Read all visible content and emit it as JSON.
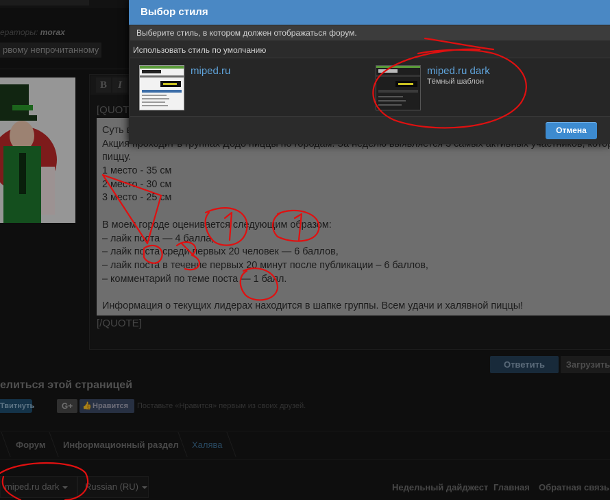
{
  "forum": {
    "moderators_label": "ераторы:",
    "moderator_name": "morax",
    "unread_button": "рвому непрочитанному",
    "editor_bold": "B",
    "editor_italic": "I",
    "quote_open": "[QUOTE",
    "quote_close": "[/QUOTE]",
    "quote_lines": [
      "Суть в",
      "Акция проходит в группах Додо пиццы по городам. За неделю выявляется 3 самых активных участников, которые получают",
      "пиццу.",
      "1 место - 35 см",
      "2 место - 30 см",
      "3 место - 25 см",
      "",
      "В моем городе оценивается следующим образом:",
      "– лайк поста — 4 балла,",
      "– лайк поста среди первых 20 человек — 6 баллов,",
      "– лайк поста в течение первых 20 минут после публикации – 6 баллов,",
      "– комментарий по теме поста — 1 балл.",
      "",
      "Информация о текущих лидерах находится в шапке группы. Всем удачи и халявной пиццы!"
    ],
    "reply_button": "Ответить",
    "upload_button": "Загрузить",
    "share_title": "елиться этой страницей",
    "tweet_button": "Твитнуть",
    "gplus_button": "G+",
    "like_button": "Нравится",
    "like_text": "Поставьте «Нравится» первым из своих друзей.",
    "breadcrumbs": [
      "Форум",
      "Информационный раздел",
      "Халява"
    ],
    "style_selector": "miped.ru dark",
    "language_selector": "Russian (RU)",
    "footer_links": [
      "Недельный дайджест",
      "Главная",
      "Обратная связь"
    ]
  },
  "modal": {
    "title": "Выбор стиля",
    "description": "Выберите стиль, в котором должен отображаться форум.",
    "default_style": "Использовать стиль по умолчанию",
    "styles": [
      {
        "name": "miped.ru",
        "subtitle": ""
      },
      {
        "name": "miped.ru dark",
        "subtitle": "Тёмный шаблон"
      }
    ],
    "cancel_button": "Отмена"
  },
  "colors": {
    "modal_header": "#4a88c4",
    "link_blue": "#5fa3da",
    "annotation_red": "#e01010"
  }
}
